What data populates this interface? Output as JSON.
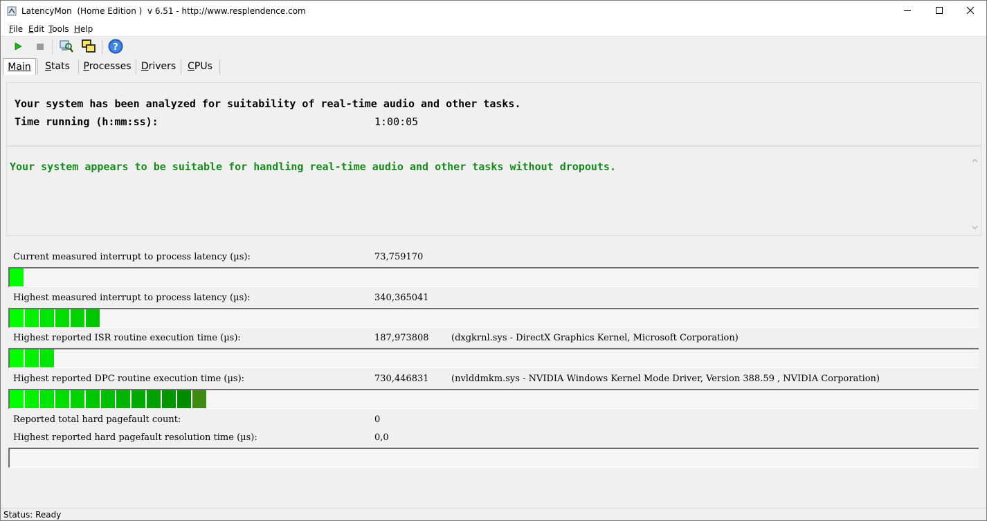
{
  "window": {
    "title": "LatencyMon  (Home Edition )  v 6.51 - http://www.resplendence.com",
    "minimize_icon": "minimize-icon",
    "maximize_icon": "maximize-icon",
    "close_icon": "close-icon"
  },
  "menu": {
    "file": {
      "key": "F",
      "rest": "ile"
    },
    "edit": {
      "key": "E",
      "rest": "dit"
    },
    "tools": {
      "key": "T",
      "rest": "ools"
    },
    "help": {
      "key": "H",
      "rest": "elp"
    }
  },
  "toolbar": {
    "icons": [
      "play-icon",
      "stop-icon",
      "analyze-icon",
      "windows-icon",
      "help-icon"
    ]
  },
  "tabs": [
    {
      "key": "M",
      "rest": "ain"
    },
    {
      "key": "S",
      "rest": "tats"
    },
    {
      "key": "P",
      "rest": "rocesses"
    },
    {
      "key": "D",
      "rest": "rivers"
    },
    {
      "key": "C",
      "rest": "PUs"
    }
  ],
  "main": {
    "analysis_line": "Your system has been analyzed for suitability of real-time audio and other tasks.",
    "time_label": "Time running (h:mm:ss):",
    "time_value": "1:00:05",
    "verdict": "Your system appears to be suitable for handling real-time audio and other tasks without dropouts.",
    "verdict_color": "#158a1a",
    "metrics": [
      {
        "label": "Current measured interrupt to process latency (µs):",
        "value": "73,759170",
        "extra": "",
        "bar_segments": 1
      },
      {
        "label": "Highest measured interrupt to process latency (µs):",
        "value": "340,365041",
        "extra": "",
        "bar_segments": 6
      },
      {
        "label": "Highest reported ISR routine execution time (µs):",
        "value": "187,973808",
        "extra": "(dxgkrnl.sys - DirectX Graphics Kernel, Microsoft Corporation)",
        "bar_segments": 3
      },
      {
        "label": "Highest reported DPC routine execution time (µs):",
        "value": "730,446831",
        "extra": "(nvlddmkm.sys - NVIDIA Windows Kernel Mode Driver, Version 388.59 , NVIDIA Corporation)",
        "bar_segments": 13
      }
    ],
    "pagefault_count_label": "Reported total hard pagefault count:",
    "pagefault_count_value": "0",
    "pagefault_time_label": "Highest reported hard pagefault resolution time (µs):",
    "pagefault_time_value": "0,0",
    "pagefault_bar_segments": 0
  },
  "status": {
    "text": "Status: Ready"
  }
}
